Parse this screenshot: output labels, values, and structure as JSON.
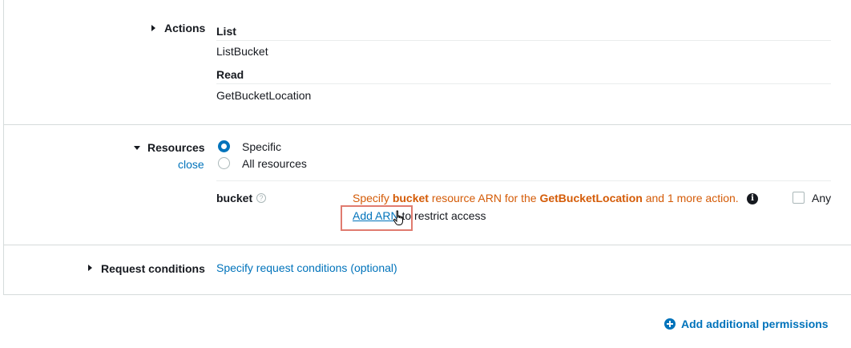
{
  "actions": {
    "label": "Actions",
    "groups": [
      {
        "heading": "List",
        "items": [
          "ListBucket"
        ]
      },
      {
        "heading": "Read",
        "items": [
          "GetBucketLocation"
        ]
      }
    ]
  },
  "resources": {
    "label": "Resources",
    "close_link": "close",
    "options": [
      {
        "label": "Specific",
        "selected": true
      },
      {
        "label": "All resources",
        "selected": false
      }
    ],
    "bucket": {
      "label": "bucket",
      "help": "?",
      "warning_prefix": "Specify ",
      "warning_resource": "bucket",
      "warning_mid": " resource ARN for the ",
      "warning_action": "GetBucketLocation",
      "warning_suffix": " and 1 more action.",
      "info": "i",
      "add_arn_link": "Add ARN",
      "add_arn_suffix": " to restrict access",
      "any_label": "Any"
    }
  },
  "request_conditions": {
    "label": "Request conditions",
    "link": "Specify request conditions (optional)"
  },
  "footer": {
    "add_permissions": "Add additional permissions"
  },
  "colors": {
    "link": "#0073bb",
    "warning": "#d45b07",
    "highlight": "#e07b6f"
  }
}
